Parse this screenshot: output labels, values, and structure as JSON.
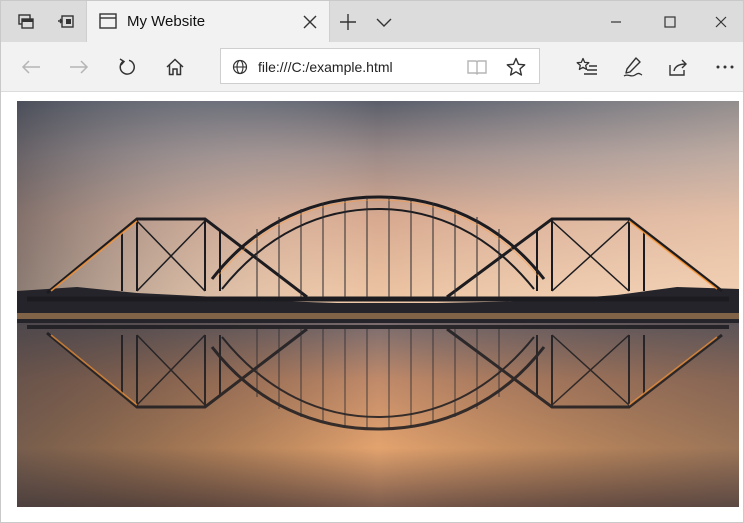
{
  "tab": {
    "title": "My Website"
  },
  "address_bar": {
    "url": "file:///C:/example.html"
  },
  "icons": {
    "set_tabs_aside": "set-tabs-aside-icon",
    "tabs_aside_list": "tabs-aside-list-icon",
    "page": "page-icon",
    "close_tab": "close-icon",
    "new_tab": "plus-icon",
    "tab_preview": "chevron-down-icon",
    "minimize": "minimize-icon",
    "maximize": "maximize-icon",
    "close_window": "close-icon",
    "back": "back-arrow-icon",
    "forward": "forward-arrow-icon",
    "refresh": "refresh-icon",
    "home": "home-icon",
    "globe": "globe-icon",
    "reading_view": "reading-view-icon",
    "favorite": "star-icon",
    "favorites_list": "favorites-list-icon",
    "web_note": "pen-icon",
    "share": "share-icon",
    "more": "more-icon"
  },
  "colors": {
    "titlebar": "#dcdcdc",
    "active_tab": "#f2f2f2",
    "toolbar": "#f2f2f2",
    "disabled_icon": "#b5b5b5",
    "icon": "#333333"
  }
}
